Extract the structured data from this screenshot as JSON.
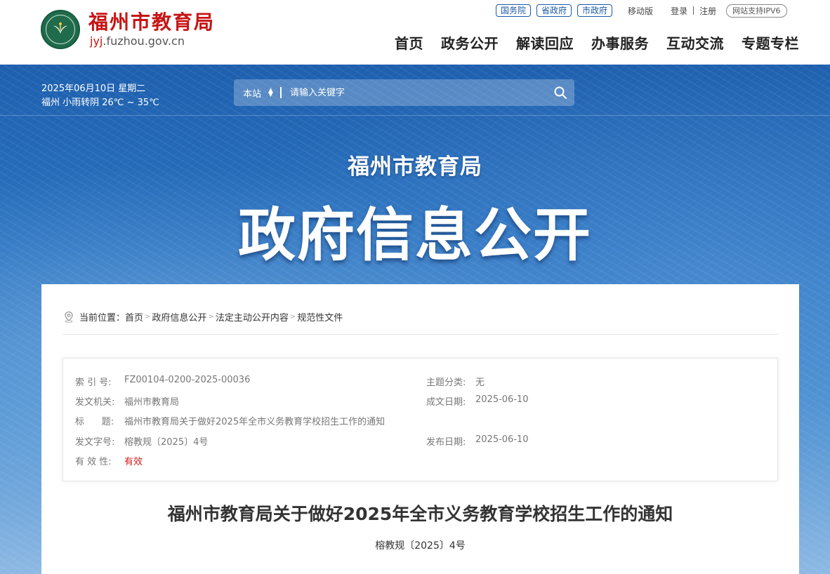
{
  "header": {
    "site_name": "福州市教育局",
    "domain_prefix": "jyj",
    "domain_rest": ".fuzhou.gov.cn",
    "gov_links": [
      "国务院",
      "省政府",
      "市政府"
    ],
    "mobile": "移动版",
    "login": "登录",
    "register": "注册",
    "ipv6": "网站支持IPV6",
    "nav": [
      "首页",
      "政务公开",
      "解读回应",
      "办事服务",
      "互动交流",
      "专题专栏"
    ]
  },
  "banner": {
    "date": "2025年06月10日 星期二",
    "weather": "福州 小雨转阴 26℃ ~ 35℃",
    "search_scope": "本站",
    "search_placeholder": "请输入关键字",
    "subtitle": "福州市教育局",
    "title": "政府信息公开"
  },
  "breadcrumb": {
    "label": "当前位置：",
    "items": [
      "首页",
      "政府信息公开",
      "法定主动公开内容",
      "规范性文件"
    ]
  },
  "info": {
    "index_label": "索 引 号:",
    "index_value": "FZ00104-0200-2025-00036",
    "topic_label": "主题分类:",
    "topic_value": "无",
    "issuer_label": "发文机关:",
    "issuer_value": "福州市教育局",
    "written_label": "成文日期:",
    "written_value": "2025-06-10",
    "title_label": "标      题:",
    "title_value": "福州市教育局关于做好2025年全市义务教育学校招生工作的通知",
    "docno_label": "发文字号:",
    "docno_value": "榕教规〔2025〕4号",
    "publish_label": "发布日期:",
    "publish_value": "2025-06-10",
    "validity_label": "有 效 性:",
    "validity_value": "有效"
  },
  "document": {
    "title": "福州市教育局关于做好2025年全市义务教育学校招生工作的通知",
    "number": "榕教规〔2025〕4号"
  },
  "colors": {
    "brand_red": "#c81414",
    "link_blue": "#1a5aa8",
    "banner_blue": "#2a73c0",
    "valid_red": "#d21919"
  }
}
